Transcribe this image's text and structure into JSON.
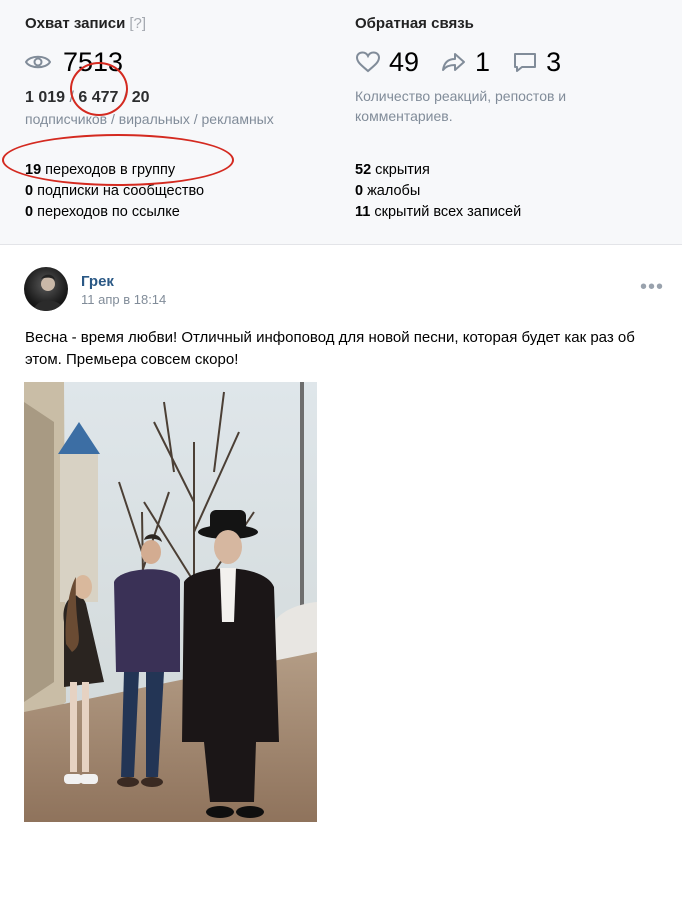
{
  "reach": {
    "title": "Охват записи",
    "help": "[?]",
    "icon": "eye-icon",
    "total": "7513",
    "subscribers": "1 019",
    "viral": "6 477",
    "ads": "20",
    "sep1": " / ",
    "sep2": " / ",
    "breakdown_label": "подписчиков / виральных / рекламных"
  },
  "feedback": {
    "title": "Обратная связь",
    "likes": "49",
    "reposts": "1",
    "comments": "3",
    "description": "Количество реакций, репостов и комментариев.",
    "icons": [
      "heart-icon",
      "repost-icon",
      "comment-icon"
    ]
  },
  "metrics_left": [
    {
      "value": "19",
      "label": " переходов в группу"
    },
    {
      "value": "0",
      "label": " подписки на сообщество"
    },
    {
      "value": "0",
      "label": " переходов по ссылке"
    }
  ],
  "metrics_right": [
    {
      "value": "52",
      "label": " скрытия"
    },
    {
      "value": "0",
      "label": " жалобы"
    },
    {
      "value": "11",
      "label": " скрытий всех записей"
    }
  ],
  "post": {
    "author": "Грек",
    "date": "11 апр в 18:14",
    "more": "•••",
    "text": "Весна - время любви! Отличный инфоповод для новой песни, которая будет как раз об этом. Премьера совсем скоро!"
  },
  "colors": {
    "accent_link": "#2a5885",
    "muted": "#818c99",
    "annotation_red": "#d42a20",
    "stats_bg": "#f7f8fa"
  }
}
